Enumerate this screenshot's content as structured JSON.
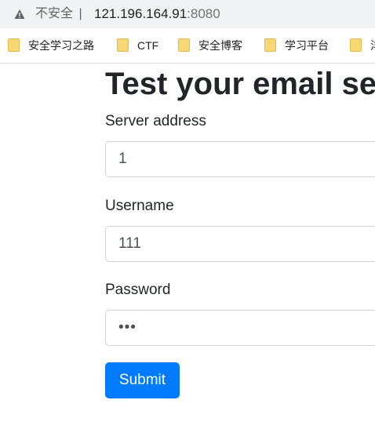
{
  "browser": {
    "security_label": "不安全",
    "separator": "|",
    "url_host": "121.196.164.91",
    "url_port": ":8080"
  },
  "bookmarks": [
    {
      "label": "安全学习之路"
    },
    {
      "label": "CTF"
    },
    {
      "label": "安全博客"
    },
    {
      "label": "学习平台"
    },
    {
      "label": "洋"
    }
  ],
  "form": {
    "title": "Test your email serv",
    "server_label": "Server address",
    "server_value": "1",
    "username_label": "Username",
    "username_value": "111",
    "password_label": "Password",
    "password_value": "•••",
    "submit_label": "Submit"
  },
  "colors": {
    "primary": "#007bff",
    "bookmark_folder": "#f8d775"
  }
}
